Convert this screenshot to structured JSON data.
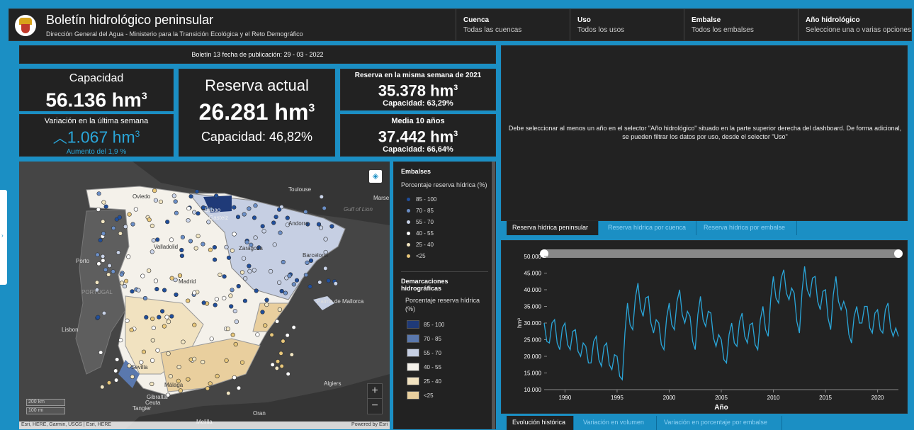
{
  "header": {
    "title": "Boletín hidrológico peninsular",
    "subtitle": "Dirección General del Agua - Ministerio para la Transición Ecológica y el Reto Demográfico",
    "filters": [
      {
        "label": "Cuenca",
        "value": "Todas las cuencas"
      },
      {
        "label": "Uso",
        "value": "Todos los usos"
      },
      {
        "label": "Embalse",
        "value": "Todos los embalses"
      },
      {
        "label": "Año hidrológico",
        "value": "Seleccione una o varias opciones"
      }
    ]
  },
  "bulletin": "Boletín 13 fecha de publicación:  29 - 03 - 2022",
  "kpis": {
    "capacity_label": "Capacidad",
    "capacity_value": "56.136 hm",
    "weekly_label": "Variación en la última semana",
    "weekly_value": "1.067 hm",
    "weekly_change": "Aumento del 1,9 %",
    "reserve_label": "Reserva actual",
    "reserve_value": "26.281 hm",
    "reserve_capacity": "Capacidad: 46,82%",
    "lastyear_label": "Reserva en la misma semana de 2021",
    "lastyear_value": "35.378 hm",
    "lastyear_capacity": "Capacidad: 63,29%",
    "avg_label": "Media 10 años",
    "avg_value": "37.442 hm",
    "avg_capacity": "Capacidad: 66,64%",
    "unit_exp": "3"
  },
  "map": {
    "places": [
      "Toulouse",
      "Marse",
      "Gulf of Lion",
      "Porto",
      "Valladolid",
      "Zaragoza",
      "Barcelona",
      "PORTUGAL",
      "Madrid",
      "Palma de Mallorca",
      "Lisbon",
      "Sevilla",
      "Málaga",
      "Gibraltar",
      "Ceuta",
      "Tangier",
      "Algiers",
      "Oran",
      "Melilla",
      "Bilbao",
      "Gasteiz",
      "Andorra",
      "Oviedo"
    ],
    "scale_km": "200 km",
    "scale_mi": "100 mi",
    "attribution": "Esri, HERE, Garmin, USGS | Esri, HERE",
    "powered": "Powered by Esri",
    "zoom_in": "+",
    "zoom_out": "−"
  },
  "legend": {
    "embalses_title": "Embalses",
    "embalses_sub": "Porcentaje reserva hídrica (%)",
    "embalses_items": [
      {
        "label": "85 - 100",
        "color": "#1f4e9c"
      },
      {
        "label": "70 - 85",
        "color": "#6b8fc7"
      },
      {
        "label": "55 - 70",
        "color": "#c9d3e8"
      },
      {
        "label": "40 - 55",
        "color": "#ffffff"
      },
      {
        "label": "25 - 40",
        "color": "#f2e6c2"
      },
      {
        "label": "<25",
        "color": "#e8c77a"
      }
    ],
    "dem_title": "Demarcaciones hidrográficas",
    "dem_sub": "Porcentaje reserva hídrica (%)",
    "dem_items": [
      {
        "label": "85 - 100",
        "color": "#1f3a78"
      },
      {
        "label": "70 - 85",
        "color": "#5a78ad"
      },
      {
        "label": "55 - 70",
        "color": "#c6cfe3"
      },
      {
        "label": "40 - 55",
        "color": "#f4f1ea"
      },
      {
        "label": "25 - 40",
        "color": "#f1e2c0"
      },
      {
        "label": "<25",
        "color": "#e9cf9e"
      }
    ]
  },
  "message": "Debe seleccionar al menos un año en el selector \"Año hidrológico\" situado en la parte superior derecha del dashboard. De forma adicional, se pueden filtrar los datos por uso, desde el selector \"Uso\"",
  "tabs_top": [
    "Reserva hídrica peninsular",
    "Reserva hídrica por cuenca",
    "Reserva hídrica por embalse"
  ],
  "tabs_bottom": [
    "Evolución histórica",
    "Variación en volumen",
    "Variación en porcentaje por embalse"
  ],
  "chart_data": {
    "type": "line",
    "xlabel": "Año",
    "ylabel": "hm³",
    "xlim": [
      1988,
      2022
    ],
    "ylim": [
      10000,
      50000
    ],
    "x_ticks": [
      1990,
      1995,
      2000,
      2005,
      2010,
      2015,
      2020
    ],
    "y_ticks": [
      10000,
      15000,
      20000,
      25000,
      30000,
      35000,
      40000,
      45000,
      50000
    ],
    "y_tick_labels": [
      "10.000",
      "15.000",
      "20.000",
      "25.000",
      "30.000",
      "35.000",
      "40.000",
      "45.000",
      "50.000"
    ],
    "series": [
      {
        "color": "#2aa6d9",
        "x": [
          1988.0,
          1988.5,
          1989.0,
          1989.5,
          1990.0,
          1990.5,
          1991.0,
          1991.5,
          1992.0,
          1992.5,
          1993.0,
          1993.5,
          1994.0,
          1994.5,
          1995.0,
          1995.5,
          1996.0,
          1996.5,
          1997.0,
          1997.5,
          1998.0,
          1998.5,
          1999.0,
          1999.5,
          2000.0,
          2000.5,
          2001.0,
          2001.5,
          2002.0,
          2002.5,
          2003.0,
          2003.5,
          2004.0,
          2004.5,
          2005.0,
          2005.5,
          2006.0,
          2006.5,
          2007.0,
          2007.5,
          2008.0,
          2008.5,
          2009.0,
          2009.5,
          2010.0,
          2010.5,
          2011.0,
          2011.5,
          2012.0,
          2012.5,
          2013.0,
          2013.5,
          2014.0,
          2014.5,
          2015.0,
          2015.5,
          2016.0,
          2016.5,
          2017.0,
          2017.5,
          2018.0,
          2018.5,
          2019.0,
          2019.5,
          2020.0,
          2020.5,
          2021.0,
          2021.5,
          2022.0
        ],
        "values": [
          30000,
          24000,
          31000,
          22000,
          30000,
          22000,
          28000,
          20000,
          23000,
          18000,
          26000,
          17000,
          24000,
          16000,
          20000,
          13000,
          36000,
          28000,
          42000,
          32000,
          38000,
          27000,
          30000,
          22000,
          36000,
          28000,
          40000,
          30000,
          32000,
          22000,
          38000,
          29000,
          33000,
          23000,
          25000,
          18000,
          30000,
          23000,
          33000,
          24000,
          30000,
          22000,
          35000,
          26000,
          44000,
          36000,
          46000,
          37000,
          39000,
          27000,
          47000,
          38000,
          44000,
          34000,
          40000,
          28000,
          44000,
          34000,
          34000,
          24000,
          35000,
          30000,
          35000,
          27000,
          34000,
          27000,
          36000,
          26000,
          26000
        ]
      }
    ]
  }
}
